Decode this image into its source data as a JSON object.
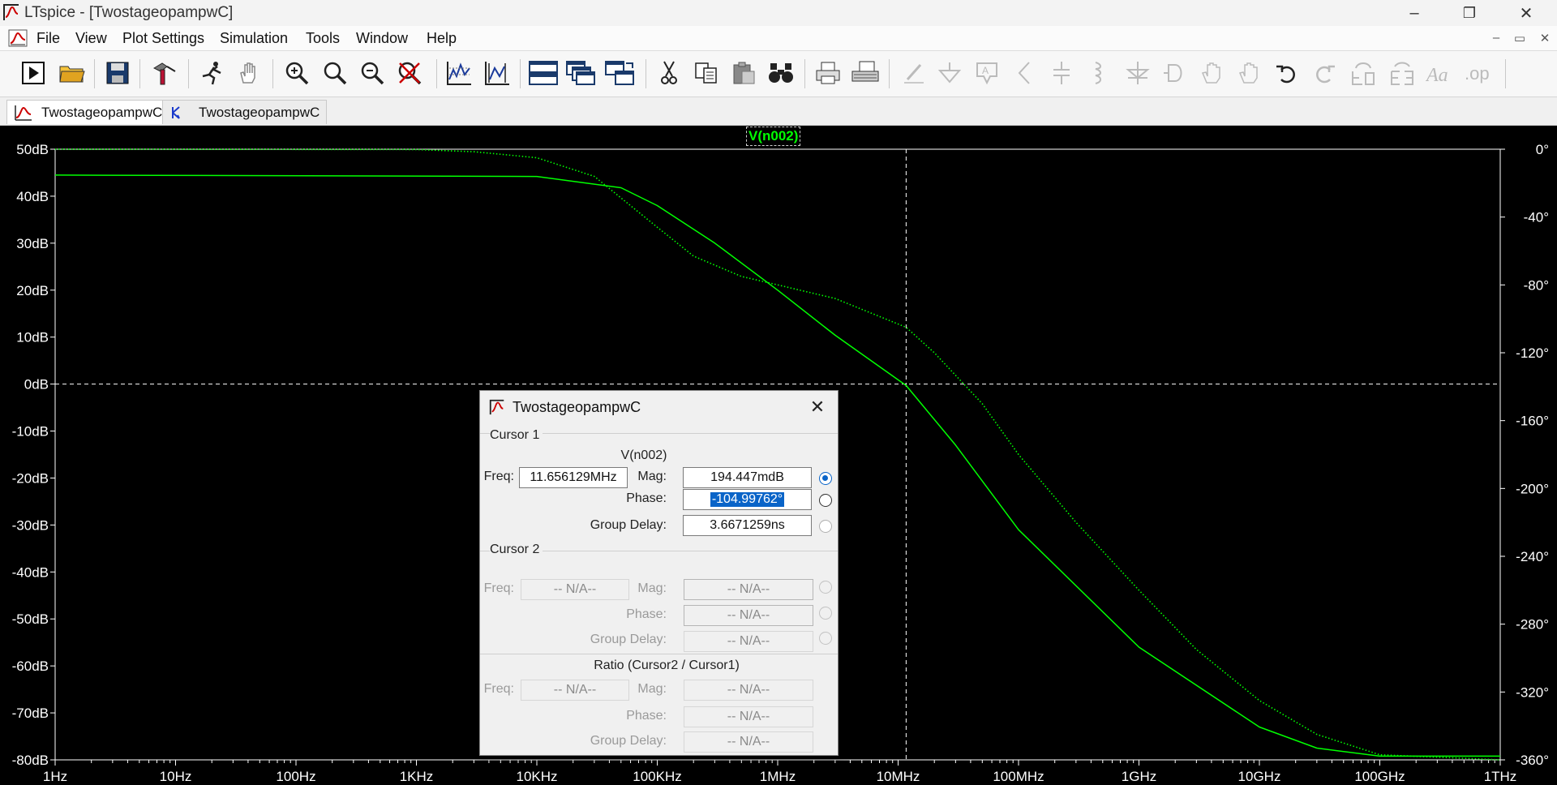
{
  "window": {
    "title": "LTspice - [TwostageopampwC]",
    "controls": {
      "minimize": "–",
      "restore": "❐",
      "close": "✕"
    }
  },
  "menu": {
    "items": [
      "File",
      "View",
      "Plot Settings",
      "Simulation",
      "Tools",
      "Window",
      "Help"
    ],
    "mdi_controls": {
      "minimize": "–",
      "restore": "▭",
      "close": "✕"
    }
  },
  "toolbar": {
    "buttons": [
      "run-icon",
      "open-icon",
      "save-icon",
      "control-panel-icon",
      "halt-icon",
      "pan-icon",
      "zoom-in-icon",
      "zoom-area-icon",
      "zoom-out-icon",
      "zoom-full-icon",
      "autorange-icon",
      "plot-settings-icon",
      "tile-horizontal-icon",
      "cascade-icon",
      "tile-vertical-icon",
      "cut-icon",
      "copy-icon",
      "paste-icon",
      "find-icon",
      "print-icon",
      "print-setup-icon",
      "wire-icon",
      "ground-icon",
      "label-net-icon",
      "resistor-icon",
      "capacitor-icon",
      "inductor-icon",
      "diode-icon",
      "component-icon",
      "move-icon",
      "drag-icon",
      "undo-icon",
      "redo-icon",
      "rotate-icon",
      "mirror-icon",
      "text-icon",
      "spice-directive-icon"
    ]
  },
  "tabs": [
    {
      "label": "TwostageopampwC",
      "icon": "waveform-icon",
      "active": true
    },
    {
      "label": "TwostageopampwC",
      "icon": "schematic-icon",
      "active": false
    }
  ],
  "plot": {
    "trace_name": "V(n002)",
    "trace_color": "#00ff00",
    "background": "#000000",
    "y_left_ticks": [
      "50dB",
      "40dB",
      "30dB",
      "20dB",
      "10dB",
      "0dB",
      "-10dB",
      "-20dB",
      "-30dB",
      "-40dB",
      "-50dB",
      "-60dB",
      "-70dB",
      "-80dB"
    ],
    "y_right_ticks": [
      "0°",
      "-40°",
      "-80°",
      "-120°",
      "-160°",
      "-200°",
      "-240°",
      "-280°",
      "-320°",
      "-360°"
    ],
    "x_ticks": [
      "1Hz",
      "10Hz",
      "100Hz",
      "1KHz",
      "10KHz",
      "100KHz",
      "1MHz",
      "10MHz",
      "100MHz",
      "1GHz",
      "10GHz",
      "100GHz",
      "1THz"
    ]
  },
  "chart_data": {
    "type": "line",
    "x_scale": "log",
    "xlim": [
      1,
      1000000000000
    ],
    "ylim_left": [
      -80,
      50
    ],
    "ylim_right": [
      -360,
      0
    ],
    "series": [
      {
        "name": "V(n002)",
        "axis": "left",
        "style": "solid",
        "x": [
          1,
          10000,
          50000,
          100000,
          300000,
          1000000,
          3000000,
          11656129,
          30000000,
          100000000,
          1000000000,
          10000000000,
          30000000000,
          100000000000,
          1000000000000
        ],
        "y": [
          44.5,
          44.2,
          41.8,
          38.0,
          30.0,
          20.0,
          10.4,
          -0.3,
          -13.0,
          -31.0,
          -56.0,
          -73.0,
          -77.5,
          -79.2,
          -79.2
        ]
      },
      {
        "name": "V(n002) phase",
        "axis": "right",
        "style": "dotted",
        "x": [
          1,
          1000,
          3000,
          10000,
          30000,
          100000,
          200000,
          500000,
          1000000,
          3000000,
          11656129,
          20000000,
          50000000,
          100000000,
          300000000,
          1000000000,
          3000000000,
          10000000000,
          30000000000,
          100000000000,
          1000000000000
        ],
        "y": [
          0,
          -0.2,
          -1.5,
          -5.0,
          -16.0,
          -46.0,
          -63.0,
          -75.0,
          -80.0,
          -88.0,
          -105.0,
          -120.0,
          -150.0,
          -180.0,
          -220.0,
          -260.0,
          -295.0,
          -325.0,
          -345.0,
          -357.0,
          -360.0
        ]
      }
    ],
    "cursor": {
      "x": 11656129,
      "y_db": 0
    }
  },
  "cursor_dialog": {
    "title": "TwostageopampwC",
    "close": "✕",
    "cursor1": {
      "label": "Cursor 1",
      "trace": "V(n002)",
      "freq_label": "Freq:",
      "freq": "11.656129MHz",
      "mag_label": "Mag:",
      "mag": "194.447mdB",
      "phase_label": "Phase:",
      "phase": "-104.99762°",
      "group_delay_label": "Group Delay:",
      "group_delay": "3.6671259ns"
    },
    "cursor2": {
      "label": "Cursor 2",
      "freq_label": "Freq:",
      "freq": "-- N/A--",
      "mag_label": "Mag:",
      "mag": "-- N/A--",
      "phase_label": "Phase:",
      "phase": "-- N/A--",
      "group_delay_label": "Group Delay:",
      "group_delay": "-- N/A--"
    },
    "ratio": {
      "label": "Ratio (Cursor2 / Cursor1)",
      "freq_label": "Freq:",
      "freq": "-- N/A--",
      "mag_label": "Mag:",
      "mag": "-- N/A--",
      "phase_label": "Phase:",
      "phase": "-- N/A--",
      "group_delay_label": "Group Delay:",
      "group_delay": "-- N/A--"
    }
  }
}
